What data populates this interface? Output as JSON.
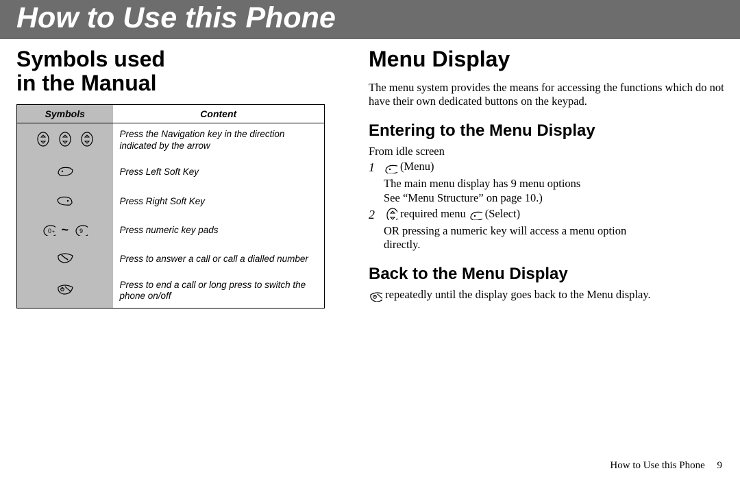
{
  "banner": {
    "title": "How to Use this Phone"
  },
  "left": {
    "heading_l1": "Symbols used",
    "heading_l2": "in the Manual",
    "table": {
      "head_symbols": "Symbols",
      "head_content": "Content",
      "rows": [
        {
          "content": "Press the Navigation key in the direction indicated by the arrow"
        },
        {
          "content": "Press Left Soft Key"
        },
        {
          "content": "Press Right Soft Key"
        },
        {
          "content": "Press numeric key pads"
        },
        {
          "content": "Press to answer a call or call a dialled number"
        },
        {
          "content": "Press to end a call or long press to switch the phone on/off"
        }
      ]
    }
  },
  "right": {
    "heading": "Menu Display",
    "intro": "The menu system provides the means for accessing the functions which do not have their own dedicated buttons on the keypad.",
    "sec1": {
      "heading": "Entering to the Menu Display",
      "lead": "From idle screen",
      "step1_text": "(Menu)",
      "step1_after_l1": "The main menu display has 9 menu options",
      "step1_after_l2": "See “Menu Structure” on page 10.)",
      "step2_mid": "required menu",
      "step2_tail": "(Select)",
      "step2_after_l1": "OR pressing a numeric key will access a menu option",
      "step2_after_l2": "directly."
    },
    "sec2": {
      "heading": "Back to the Menu Display",
      "text_after_icon": "repeatedly until the display goes back to the Menu display."
    }
  },
  "footer": {
    "text": "How to Use this Phone",
    "page": "9"
  }
}
